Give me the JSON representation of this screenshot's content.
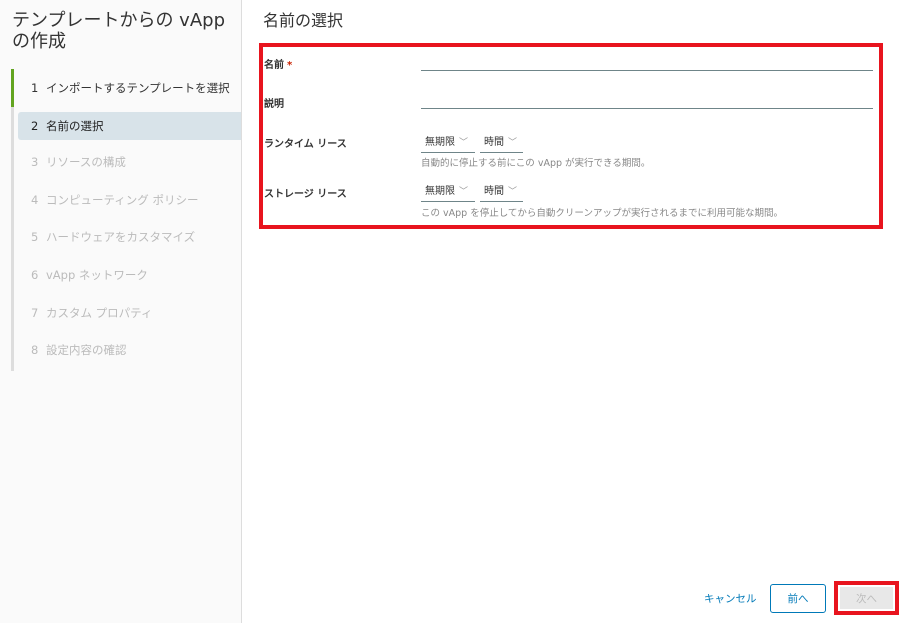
{
  "wizard": {
    "title": "テンプレートからの vApp の作成",
    "steps": [
      {
        "num": "1",
        "label": "インポートするテンプレートを選択"
      },
      {
        "num": "2",
        "label": "名前の選択"
      },
      {
        "num": "3",
        "label": "リソースの構成"
      },
      {
        "num": "4",
        "label": "コンピューティング ポリシー"
      },
      {
        "num": "5",
        "label": "ハードウェアをカスタマイズ"
      },
      {
        "num": "6",
        "label": "vApp ネットワーク"
      },
      {
        "num": "7",
        "label": "カスタム プロパティ"
      },
      {
        "num": "8",
        "label": "設定内容の確認"
      }
    ]
  },
  "page": {
    "title": "名前の選択",
    "name": {
      "label": "名前",
      "required": "*",
      "value": ""
    },
    "description": {
      "label": "説明",
      "value": ""
    },
    "runtime_lease": {
      "label": "ランタイム リース",
      "value": "無期限",
      "unit": "時間",
      "help": "自動的に停止する前にこの vApp が実行できる期間。"
    },
    "storage_lease": {
      "label": "ストレージ リース",
      "value": "無期限",
      "unit": "時間",
      "help": "この vApp を停止してから自動クリーンアップが実行されるまでに利用可能な期間。"
    }
  },
  "footer": {
    "cancel": "キャンセル",
    "back": "前へ",
    "next": "次へ"
  }
}
